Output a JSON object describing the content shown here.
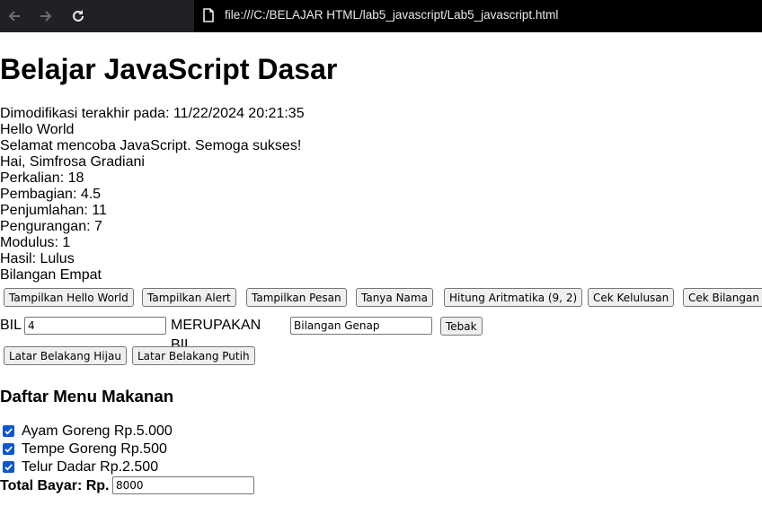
{
  "browser": {
    "url": "file:///C:/BELAJAR HTML/lab5_javascript/Lab5_javascript.html"
  },
  "page": {
    "title": "Belajar JavaScript Dasar",
    "lines": [
      "Dimodifikasi terakhir pada: 11/22/2024 20:21:35",
      "Hello World",
      "Selamat mencoba JavaScript. Semoga sukses!",
      "Hai, Simfrosa Gradiani",
      "Perkalian: 18",
      "Pembagian: 4.5",
      "Penjumlahan: 11",
      "Pengurangan: 7",
      "Modulus: 1",
      "Hasil: Lulus",
      "Bilangan Empat"
    ],
    "buttons": {
      "hello_world": "Tampilkan Hello World",
      "alert": "Tampilkan Alert",
      "pesan": "Tampilkan Pesan",
      "tanya_nama": "Tanya Nama",
      "aritmatika": "Hitung Aritmatika (9, 2)",
      "kelulusan": "Cek Kelulusan",
      "bilangan": "Cek Bilangan"
    },
    "bil_form": {
      "label": "BIL",
      "input_value": "4",
      "middle_label": "MERUPAKAN BIL",
      "result_value": "Bilangan Genap",
      "tebak_label": "Tebak"
    },
    "background_buttons": {
      "green": "Latar Belakang Hijau",
      "white": "Latar Belakang Putih"
    },
    "menu": {
      "heading": "Daftar Menu Makanan",
      "items": [
        {
          "label": "Ayam Goreng Rp.5.000",
          "checked": true
        },
        {
          "label": "Tempe Goreng Rp.500",
          "checked": true
        },
        {
          "label": "Telur Dadar Rp.2.500",
          "checked": true
        }
      ],
      "total_label": "Total Bayar: Rp.",
      "total_value": "8000"
    }
  },
  "colors": {
    "toolbar": "#202124",
    "checkbox": "#0b57d0"
  }
}
